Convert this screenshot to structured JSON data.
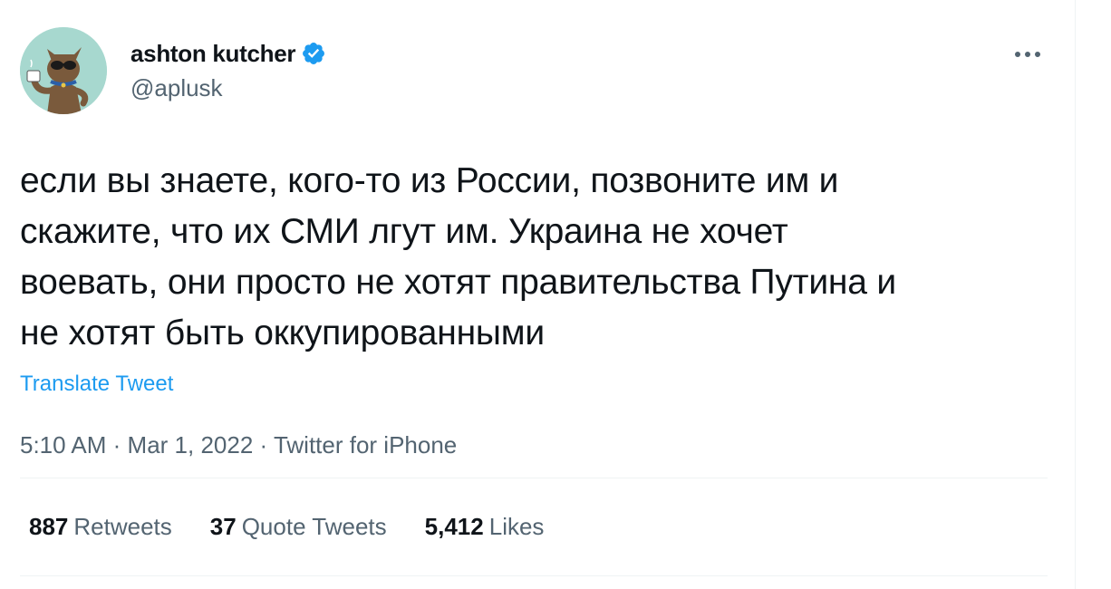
{
  "author": {
    "display_name": "ashton kutcher",
    "handle": "@aplusk",
    "verified": true
  },
  "icons": {
    "avatar": "cartoon-cat-avatar",
    "verified": "verified-badge-icon",
    "more": "more-options-icon"
  },
  "tweet": {
    "text": "если вы знаете, кого-то из России, позвоните им и\nскажите, что их СМИ лгут им. Украина не хочет\nвоевать, они просто не хотят правительства Путина и\nне хотят быть оккупированными",
    "translate_label": "Translate Tweet"
  },
  "meta": {
    "time": "5:10 AM",
    "separator": "·",
    "date": "Mar 1, 2022",
    "source": "Twitter for iPhone"
  },
  "stats": {
    "retweets": {
      "count": "887",
      "label": "Retweets"
    },
    "quotes": {
      "count": "37",
      "label": "Quote Tweets"
    },
    "likes": {
      "count": "5,412",
      "label": "Likes"
    }
  },
  "colors": {
    "accent": "#1d9bf0",
    "text": "#0f1419",
    "secondary": "#536471",
    "divider": "#eff3f4",
    "avatar_bg": "#a7d8cf"
  }
}
